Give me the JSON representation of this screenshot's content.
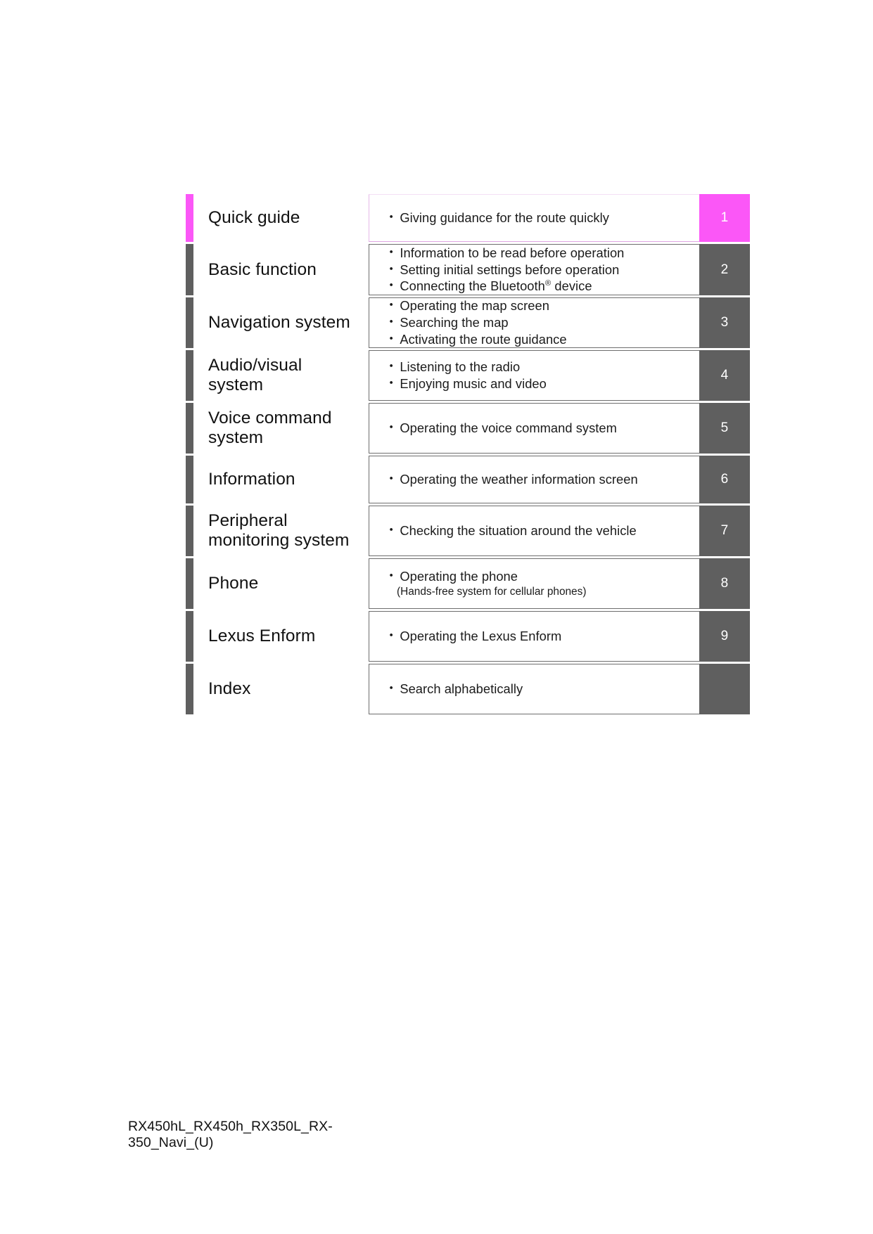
{
  "document": {
    "footer_text_line1": "RX450hL_RX450h_RX350L_RX-",
    "footer_text_line2": "350_Navi_(U)"
  },
  "theme": {
    "accent_color": "#fb57f7",
    "tab_color": "#5f5f5f",
    "text_color": "#1b1b1b",
    "border_color": "#6e6e6e",
    "accent_border_color": "#dfa6e2"
  },
  "toc": {
    "rows": [
      {
        "title": "Quick guide",
        "tab_number": "1",
        "accent": true,
        "bullets": [
          {
            "text": "Giving guidance for the route quickly"
          }
        ],
        "sub_lines": []
      },
      {
        "title": "Basic function",
        "tab_number": "2",
        "accent": false,
        "bullets": [
          {
            "text": "Information to be read before operation"
          },
          {
            "text": "Setting initial settings before operation"
          },
          {
            "text": "Connecting the Bluetooth® device",
            "html": "Connecting the Bluetooth<sup class=\"reg\">®</sup> device"
          }
        ],
        "sub_lines": []
      },
      {
        "title": "Navigation system",
        "tab_number": "3",
        "accent": false,
        "bullets": [
          {
            "text": "Operating the map screen"
          },
          {
            "text": "Searching the map"
          },
          {
            "text": "Activating the route guidance"
          }
        ],
        "sub_lines": []
      },
      {
        "title": "Audio/visual system",
        "title_line1": "Audio/visual",
        "title_line2": "system",
        "tab_number": "4",
        "accent": false,
        "bullets": [
          {
            "text": "Listening to the radio"
          },
          {
            "text": "Enjoying music and video"
          }
        ],
        "sub_lines": []
      },
      {
        "title": "Voice command system",
        "title_line1": "Voice command",
        "title_line2": "system",
        "tab_number": "5",
        "accent": false,
        "bullets": [
          {
            "text": "Operating the voice command system"
          }
        ],
        "sub_lines": []
      },
      {
        "title": "Information",
        "tab_number": "6",
        "accent": false,
        "bullets": [
          {
            "text": "Operating the weather information screen"
          }
        ],
        "sub_lines": []
      },
      {
        "title": "Peripheral monitoring system",
        "title_line1": "Peripheral",
        "title_line2": "monitoring system",
        "tab_number": "7",
        "accent": false,
        "bullets": [
          {
            "text": "Checking the situation around the vehicle"
          }
        ],
        "sub_lines": []
      },
      {
        "title": "Phone",
        "tab_number": "8",
        "accent": false,
        "bullets": [
          {
            "text": "Operating the phone"
          }
        ],
        "sub_lines": [
          {
            "text": "(Hands-free system for cellular phones)"
          }
        ]
      },
      {
        "title": "Lexus Enform",
        "tab_number": "9",
        "accent": false,
        "bullets": [
          {
            "text": "Operating the Lexus Enform"
          }
        ],
        "sub_lines": []
      },
      {
        "title": "Index",
        "tab_number": "",
        "accent": false,
        "bullets": [
          {
            "text": "Search alphabetically"
          }
        ],
        "sub_lines": []
      }
    ]
  }
}
